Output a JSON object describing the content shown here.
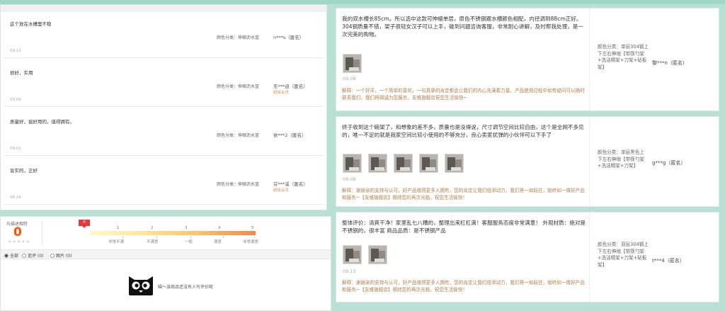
{
  "left_reviews": [
    {
      "text": "这个放在水槽里不稳",
      "color": "颜色分类：伸缩沥水篮",
      "user": "n***s（匿名）",
      "member": "",
      "date": "09.13"
    },
    {
      "text": "很好，实用",
      "color": "颜色分类：伸缩沥水篮",
      "user": "东***迪（匿名）",
      "member": "超级会员",
      "date": "09.09"
    },
    {
      "text": "质量好，挺好用的，值得拥有。",
      "color": "颜色分类：伸缩沥水篮",
      "user": "依***2（匿名）",
      "member": "",
      "date": "09.01"
    },
    {
      "text": "盲实的，正好",
      "color": "颜色分类：伸缩沥水篮",
      "user": "芬***溪（匿名）",
      "member": "超级会员",
      "date": "08.29"
    }
  ],
  "rating_summary": {
    "label": "与描述相符",
    "score": "0",
    "stars": "★★★★★",
    "marker": "0",
    "scale_numbers": [
      "1",
      "2",
      "3",
      "4",
      "5"
    ],
    "scale_labels": [
      "非常不满",
      "不满意",
      "一般",
      "满意",
      "非常满意"
    ]
  },
  "filter_options": [
    {
      "label": "全部",
      "selected": true
    },
    {
      "label": "追评 (0)",
      "selected": false
    },
    {
      "label": "图片 (0)",
      "selected": false
    }
  ],
  "empty_state": {
    "icon": "tmall-cat-icon",
    "text": "喵～该商品还没有人写评价呢"
  },
  "right_reviews": [
    {
      "text": "我的双水槽长85cm。所以选中这款可伸缩单层，原色不锈钢跟水槽颜色相配，内径调到88cm正好。304钢质量不错，架子很轻女汉子可以上手，碰到问题咨询客服，非常耐心讲解，及时帮我处理，是一次完美的购物。",
      "image_count": 1,
      "date": "09.08",
      "reply": "解释：一个好评，一个简单的喜欢，一句真挚的肯定都会让我们的内心充满着力量。产品使用过程中如有疑问可以随时联系我们，我们将竭诚为您服务，友维旗舰店祝您生活愉快~",
      "color": "颜色分类：单层304钢上下左右伸缩【带筷勺架+洗洁精架+刀架+砧板架】",
      "user": "黎***n（匿名）"
    },
    {
      "text": "终于收到这个碗架了，和想象的差不多，质量也是没得说，尺寸调节空间比较自由，这个是全网不多见的，唯一不足的就是我家空间比较小使用的不够充分，良心卖家扰弹的小伙伴可以下手了",
      "image_count": 5,
      "date": "09.08",
      "reply": "解释：谢谢亲的支持与认可，好产品值得更多人拥有，您的肯定让我们倍添动力，我们将一如既往，始终如一做好产品和服务~【友维旗舰店】期待您的再次光临，祝您生活愉快！",
      "color": "颜色分类：单层黑色上下左右伸缩【带筷勺架+洗洁精架+刀架】",
      "user": "g***g（匿名）"
    },
    {
      "text": "整体评价：清爽干净！家里乱七八糟的，整理出来杠杠滴！客服服务态度非常满意！ 外观材质：绝对是不锈钢的，很丰富 商品品质：是不锈钢产品",
      "image_count": 2,
      "date": "09.13",
      "reply": "解释：谢谢亲的支持与认可，好产品值得更多人拥有，您的肯定让我们倍添动力，我们将一如既往，始终如一做好产品和服务~【友维旗舰店】期待您的再次光临，祝您生活愉快！",
      "color": "颜色分类：双层304钢上下左右伸缩【带筷勺架+洗洁精架+刀架+砧板架】",
      "user": "t***4（匿名）"
    }
  ],
  "colors": {
    "score": "#ff5000",
    "reply": "#b07f4b",
    "member": "#c9a060",
    "marker": "#e4393c",
    "page_bg": "#b9e0d4"
  }
}
